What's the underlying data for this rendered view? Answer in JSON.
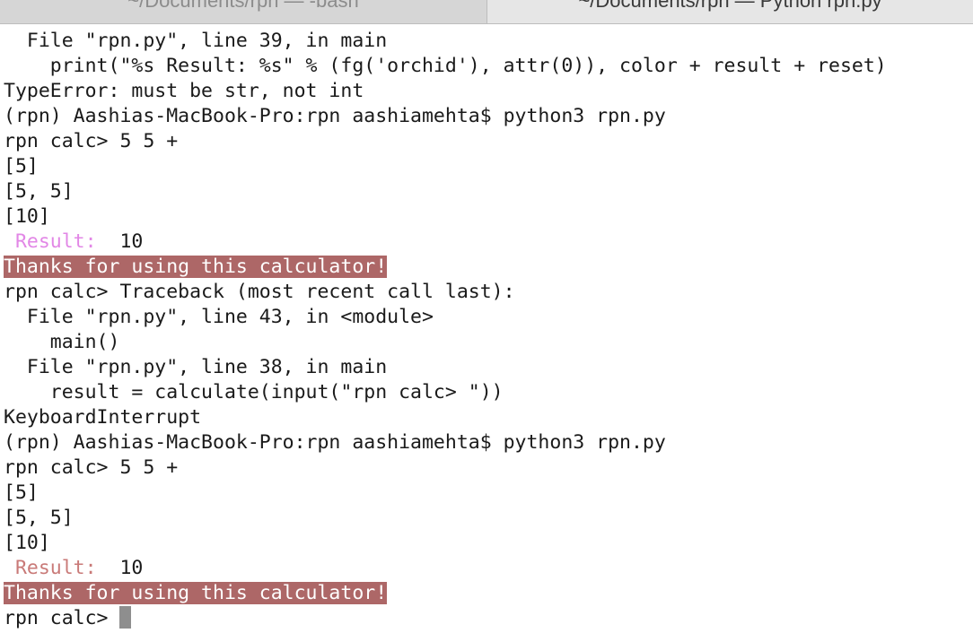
{
  "tabs": [
    {
      "label": "~/Documents/rpn — -bash"
    },
    {
      "label": "~/Documents/rpn — Python rpn.py"
    }
  ],
  "colors": {
    "result_pink": "#e287e6",
    "result_rose": "#c97a78",
    "highlight_bg": "#ad6767"
  },
  "lines": {
    "l0": "  File \"rpn.py\", line 39, in main",
    "l1": "    print(\"%s Result: %s\" % (fg('orchid'), attr(0)), color + result + reset)",
    "l2": "TypeError: must be str, not int",
    "l3": "(rpn) Aashias-MacBook-Pro:rpn aashiamehta$ python3 rpn.py",
    "l4": "rpn calc> 5 5 +",
    "l5": "[5]",
    "l6": "[5, 5]",
    "l7": "[10]",
    "l8_label": " Result: ",
    "l8_value": " 10",
    "l9": "Thanks for using this calculator!",
    "l10": "rpn calc> Traceback (most recent call last):",
    "l11": "  File \"rpn.py\", line 43, in <module>",
    "l12": "    main()",
    "l13": "  File \"rpn.py\", line 38, in main",
    "l14": "    result = calculate(input(\"rpn calc> \"))",
    "l15": "KeyboardInterrupt",
    "l16": "(rpn) Aashias-MacBook-Pro:rpn aashiamehta$ python3 rpn.py",
    "l17": "rpn calc> 5 5 +",
    "l18": "[5]",
    "l19": "[5, 5]",
    "l20": "[10]",
    "l21_label": " Result: ",
    "l21_value": " 10",
    "l22": "Thanks for using this calculator!",
    "l23": "rpn calc> "
  }
}
